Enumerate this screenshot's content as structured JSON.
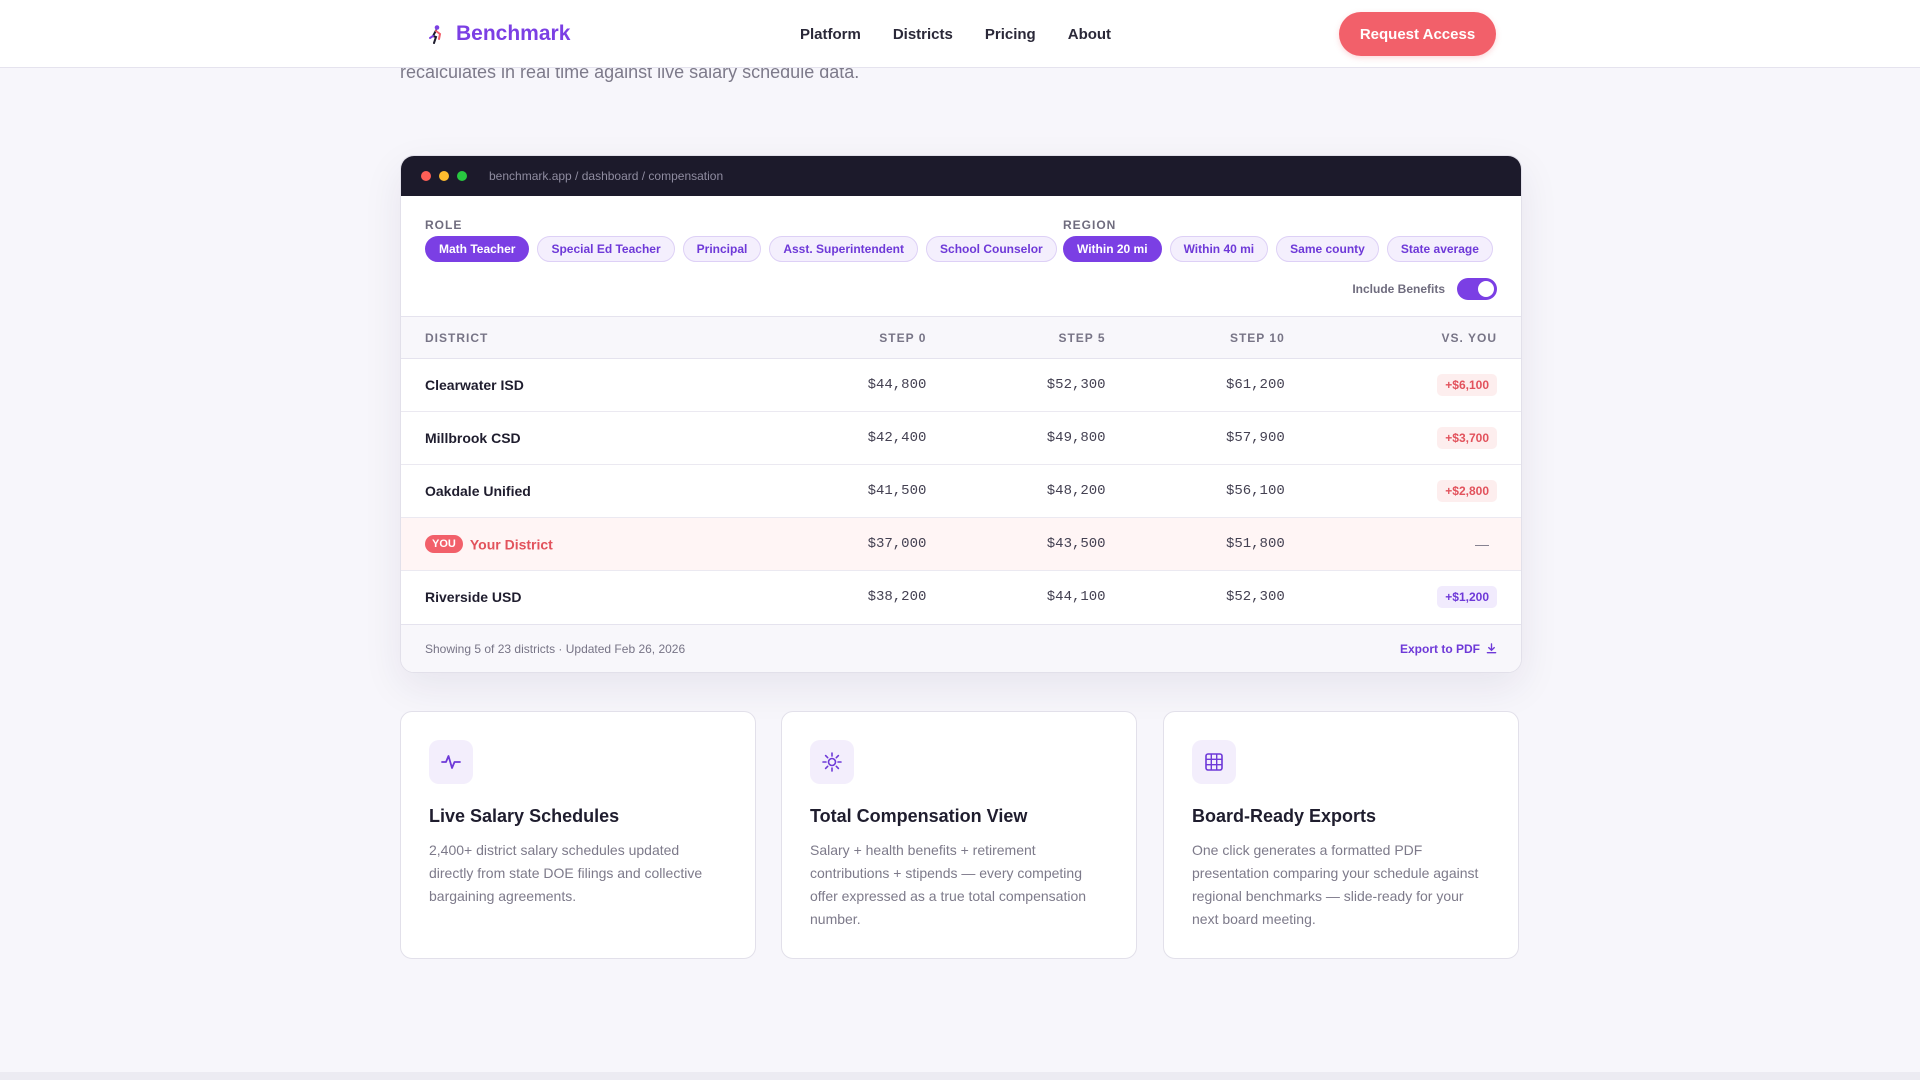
{
  "brand": {
    "name": "Benchmark",
    "icon": "runner-icon"
  },
  "nav": {
    "links": [
      "Platform",
      "Districts",
      "Pricing",
      "About"
    ],
    "cta": "Request Access"
  },
  "hero": {
    "subtitle": "recalculates in real time against live salary schedule data."
  },
  "window": {
    "url": "benchmark.app / dashboard / compensation",
    "dots": [
      "#ff5f57",
      "#febc2e",
      "#28c840"
    ]
  },
  "filters": {
    "role_label": "ROLE",
    "roles": [
      "Math Teacher",
      "Special Ed Teacher",
      "Principal",
      "Asst. Superintendent",
      "School Counselor"
    ],
    "role_selected": "Math Teacher",
    "region_label": "REGION",
    "regions": [
      "Within 20 mi",
      "Within 40 mi",
      "Same county",
      "State average"
    ],
    "region_selected": "Within 20 mi",
    "benefits_label": "Include Benefits",
    "benefits_on": true
  },
  "table": {
    "headers": [
      "DISTRICT",
      "STEP 0",
      "STEP 5",
      "STEP 10",
      "VS. YOU"
    ],
    "rows": [
      {
        "district": "Clearwater ISD",
        "step0": "$44,800",
        "step5": "$52,300",
        "step10": "$61,200",
        "vs": "+$6,100",
        "style": "pos"
      },
      {
        "district": "Millbrook CSD",
        "step0": "$42,400",
        "step5": "$49,800",
        "step10": "$57,900",
        "vs": "+$3,700",
        "style": "pos"
      },
      {
        "district": "Oakdale Unified",
        "step0": "$41,500",
        "step5": "$48,200",
        "step10": "$56,100",
        "vs": "+$2,800",
        "style": "pos"
      },
      {
        "district": "Your District",
        "badge": "YOU",
        "step0": "$37,000",
        "step5": "$43,500",
        "step10": "$51,800",
        "vs": "—",
        "style": "none",
        "is_you": true
      },
      {
        "district": "Riverside USD",
        "step0": "$38,200",
        "step5": "$44,100",
        "step10": "$52,300",
        "vs": "+$1,200",
        "style": "purple"
      }
    ],
    "footer_note": "Showing 5 of 23 districts · Updated Feb 26, 2026",
    "export_label": "Export to PDF"
  },
  "features": [
    {
      "icon": "pulse-icon",
      "title": "Live Salary Schedules",
      "text": "2,400+ district salary schedules updated directly from state DOE filings and collective bargaining agreements."
    },
    {
      "icon": "sun-icon",
      "title": "Total Compensation View",
      "text": "Salary + health benefits + retirement contributions + stipends — every competing offer expressed as a true total compensation number."
    },
    {
      "icon": "grid-icon",
      "title": "Board-Ready Exports",
      "text": "One click generates a formatted PDF presentation comparing your schedule against regional benchmarks — slide-ready for your next board meeting."
    }
  ],
  "colors": {
    "accent": "#7b3fe4",
    "cta": "#f2606a",
    "dark": "#1c1a2b"
  }
}
